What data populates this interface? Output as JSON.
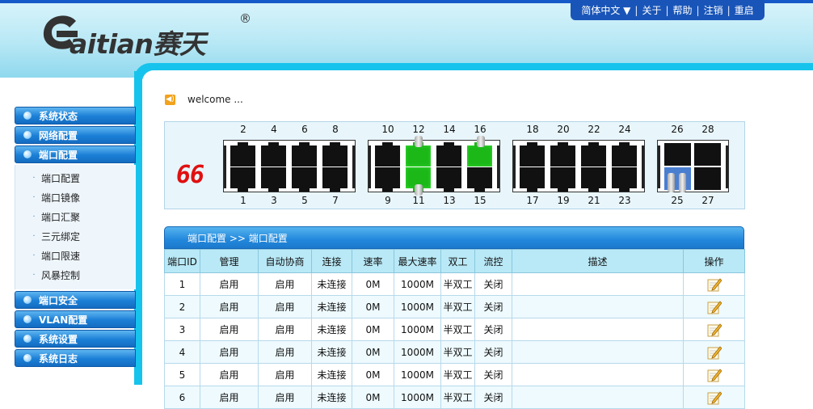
{
  "brand": {
    "name": "aitian赛天",
    "reg": "®"
  },
  "topnav": {
    "lang": "简体中文 ▼",
    "about": "关于",
    "help": "帮助",
    "logout": "注销",
    "restart": "重启",
    "sep": "|"
  },
  "welcome": {
    "text": "welcome ..."
  },
  "port_count_display": "66",
  "sidebar": {
    "items": [
      {
        "label": "系统状态"
      },
      {
        "label": "网络配置"
      },
      {
        "label": "端口配置"
      }
    ],
    "sub_items": [
      {
        "label": "端口配置"
      },
      {
        "label": "端口镜像"
      },
      {
        "label": "端口汇聚"
      },
      {
        "label": "三元绑定"
      },
      {
        "label": "端口限速"
      },
      {
        "label": "风暴控制"
      }
    ],
    "items_after": [
      {
        "label": "端口安全"
      },
      {
        "label": "VLAN配置"
      },
      {
        "label": "系统设置"
      },
      {
        "label": "系统日志"
      }
    ]
  },
  "ports": {
    "top": [
      "2",
      "4",
      "6",
      "8",
      "10",
      "12",
      "14",
      "16",
      "18",
      "20",
      "22",
      "24",
      "26",
      "28"
    ],
    "bottom": [
      "1",
      "3",
      "5",
      "7",
      "9",
      "11",
      "13",
      "15",
      "17",
      "19",
      "21",
      "23",
      "25",
      "27"
    ],
    "link_up": [
      "11",
      "12",
      "16",
      "25"
    ]
  },
  "table": {
    "title": "端口配置 >> 端口配置",
    "headers": [
      "端口ID",
      "管理",
      "自动协商",
      "连接",
      "速率",
      "最大速率",
      "双工",
      "流控",
      "描述",
      "操作"
    ],
    "rows": [
      [
        "1",
        "启用",
        "启用",
        "未连接",
        "0M",
        "1000M",
        "半双工",
        "关闭",
        ""
      ],
      [
        "2",
        "启用",
        "启用",
        "未连接",
        "0M",
        "1000M",
        "半双工",
        "关闭",
        ""
      ],
      [
        "3",
        "启用",
        "启用",
        "未连接",
        "0M",
        "1000M",
        "半双工",
        "关闭",
        ""
      ],
      [
        "4",
        "启用",
        "启用",
        "未连接",
        "0M",
        "1000M",
        "半双工",
        "关闭",
        ""
      ],
      [
        "5",
        "启用",
        "启用",
        "未连接",
        "0M",
        "1000M",
        "半双工",
        "关闭",
        ""
      ],
      [
        "6",
        "启用",
        "启用",
        "未连接",
        "0M",
        "1000M",
        "半双工",
        "关闭",
        ""
      ]
    ]
  },
  "colors": {
    "accent": "#1659c8",
    "band": "#16c3ec",
    "led": "#e01010",
    "link_up": "#1bb818"
  }
}
